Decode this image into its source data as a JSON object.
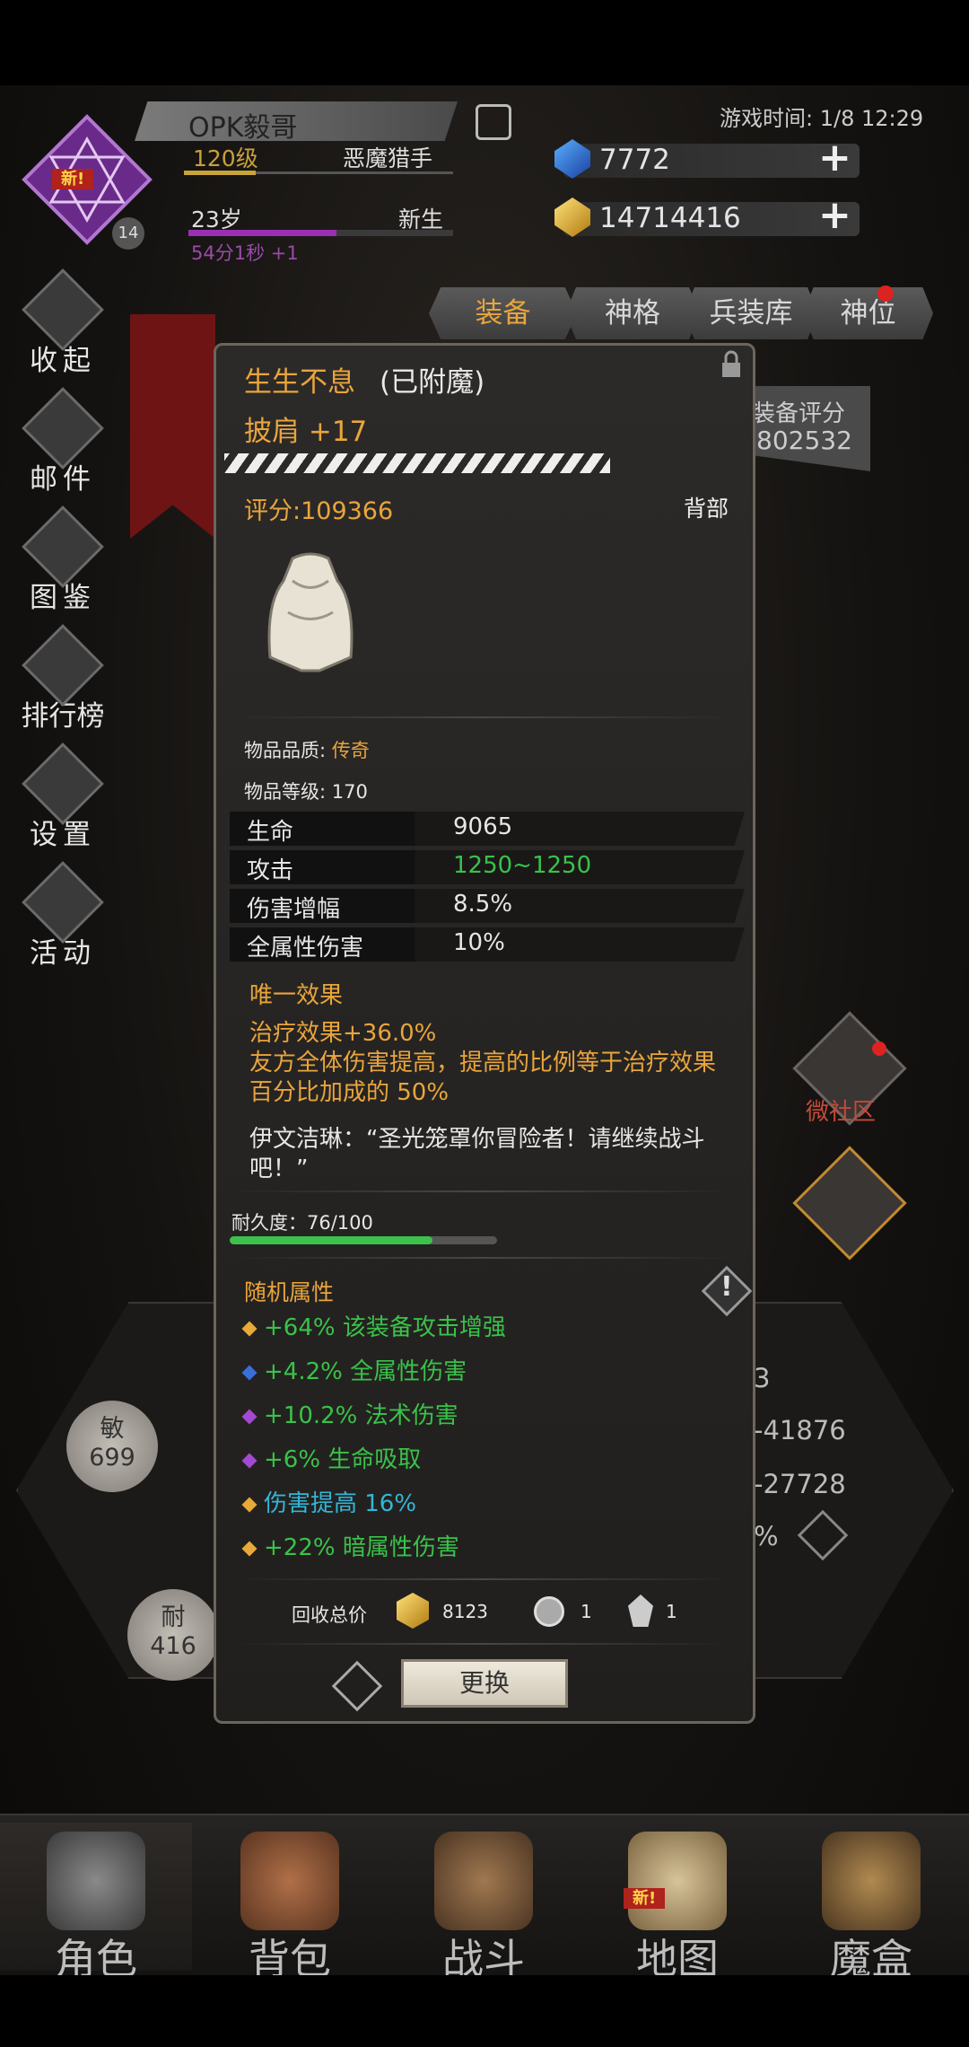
{
  "header": {
    "player_name": "OPK毅哥",
    "level": "120级",
    "class": "恶魔猎手",
    "age": "23岁",
    "stage": "新生",
    "timer": "54分1秒 +1",
    "game_time": "游戏时间: 1/8 12:29",
    "avatar_badge": "新!",
    "avatar_count": "14",
    "blue_gem": "7772",
    "gold": "14714416"
  },
  "side_menu": [
    "收起",
    "邮件",
    "图鉴",
    "排行榜",
    "设置",
    "活动"
  ],
  "tabs": [
    "装备",
    "神格",
    "兵装库",
    "神位"
  ],
  "equip_score_label": "装备评分",
  "equip_score_value": "802532",
  "item": {
    "name": "生生不息",
    "enchant": "(已附魔)",
    "slot_name": "披肩 +17",
    "score": "评分:109366",
    "part": "背部",
    "quality_label": "物品品质:",
    "quality_value": "传奇",
    "level_label": "物品等级:",
    "level_value": "170",
    "stats": [
      {
        "k": "生命",
        "v": "9065"
      },
      {
        "k": "攻击",
        "v": "1250~1250"
      },
      {
        "k": "伤害增幅",
        "v": "8.5%"
      },
      {
        "k": "全属性伤害",
        "v": "10%"
      }
    ],
    "unique_title": "唯一效果",
    "unique_text": "治疗效果+36.0%\n友方全体伤害提高，提高的比例等于治疗效果百分比加成的 50%",
    "quote": "伊文洁琳：“圣光笼罩你冒险者！请继续战斗吧！”",
    "durability_label": "耐久度：76/100",
    "durability": 0.76,
    "random_title": "随机属性",
    "random_attrs": [
      {
        "text": "+64% 该装备攻击增强",
        "color": "#39c24a",
        "gem": "#e8a93b"
      },
      {
        "text": "+4.2% 全属性伤害",
        "color": "#39c24a",
        "gem": "#3a6fd9"
      },
      {
        "text": "+10.2% 法术伤害",
        "color": "#39c24a",
        "gem": "#a24ad0"
      },
      {
        "text": "+6% 生命吸取",
        "color": "#39c24a",
        "gem": "#a24ad0"
      },
      {
        "text": "伤害提高 16%",
        "color": "#33b6d6",
        "gem": "#e8a93b"
      },
      {
        "text": "+22% 暗属性伤害",
        "color": "#39c24a",
        "gem": "#e8a93b"
      }
    ],
    "recycle_label": "回收总价",
    "recycle_gold": "8123",
    "recycle_item1": "1",
    "recycle_item2": "1",
    "replace_button": "更换"
  },
  "background_stats": {
    "min": "敏",
    "min_val": "699",
    "nai": "耐",
    "nai_val": "416",
    "r1": "3",
    "r2": "-41876",
    "r3": "-27728",
    "r4": "%",
    "social": "微社区"
  },
  "nav": [
    "角色",
    "背包",
    "战斗",
    "地图",
    "魔盒"
  ],
  "nav_new_tag": "新!"
}
